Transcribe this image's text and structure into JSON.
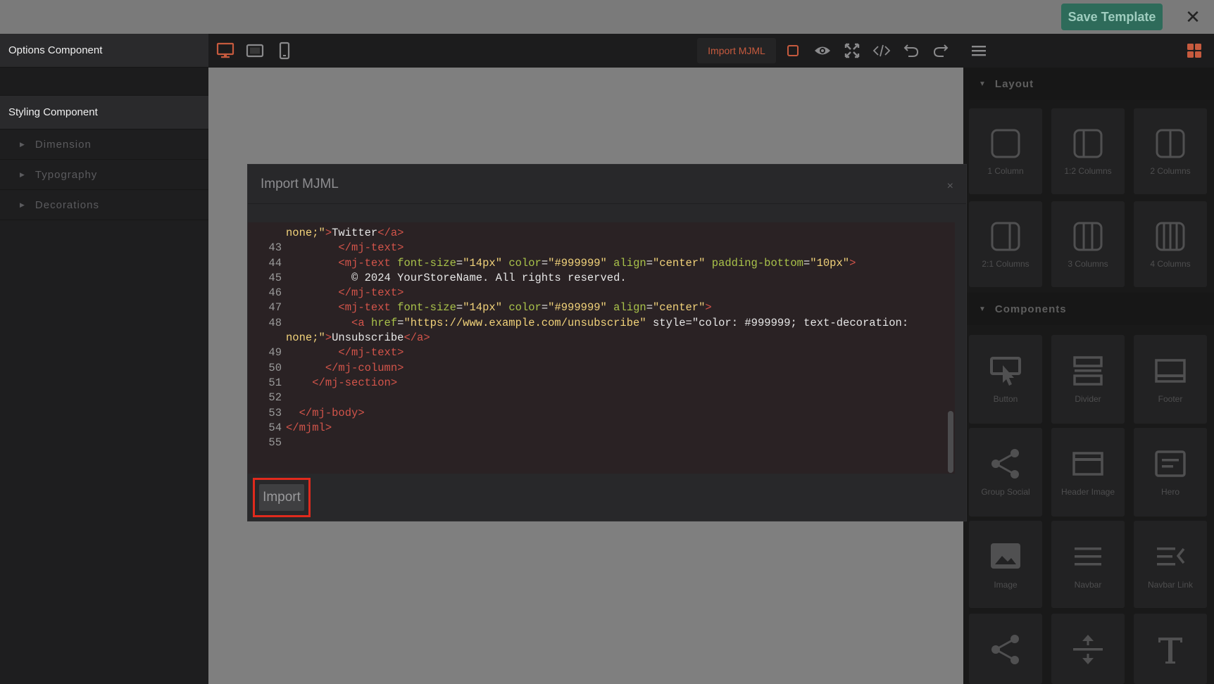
{
  "header": {
    "save_label": "Save Template",
    "close_glyph": "✕"
  },
  "left_panel": {
    "options_title": "Options Component",
    "styling_title": "Styling Component",
    "sections": [
      "Dimension",
      "Typography",
      "Decorations"
    ]
  },
  "toolbar": {
    "import_mjml_label": "Import MJML",
    "icons": [
      "desktop-icon",
      "tablet-icon",
      "mobile-icon",
      "square-outline-icon",
      "eye-icon",
      "fullscreen-icon",
      "code-icon",
      "undo-icon",
      "redo-icon",
      "menu-icon",
      "grid-icon"
    ]
  },
  "right_panel": {
    "layout_title": "Layout",
    "layout_blocks": [
      "1 Column",
      "1:2 Columns",
      "2 Columns",
      "2:1 Columns",
      "3 Columns",
      "4 Columns"
    ],
    "components_title": "Components",
    "component_blocks": [
      "Button",
      "Divider",
      "Footer",
      "Group Social",
      "Header Image",
      "Hero",
      "Image",
      "Navbar",
      "Navbar Link"
    ]
  },
  "modal": {
    "title": "Import MJML",
    "close_glyph": "×",
    "import_label": "Import",
    "code_lines": [
      {
        "n": "",
        "t": "none;\">Twitter</a>"
      },
      {
        "n": "43",
        "t": "        </mj-text>"
      },
      {
        "n": "44",
        "t": "        <mj-text font-size=\"14px\" color=\"#999999\" align=\"center\" padding-bottom=\"10px\">"
      },
      {
        "n": "45",
        "t": "          © 2024 YourStoreName. All rights reserved."
      },
      {
        "n": "46",
        "t": "        </mj-text>"
      },
      {
        "n": "47",
        "t": "        <mj-text font-size=\"14px\" color=\"#999999\" align=\"center\">"
      },
      {
        "n": "48",
        "t": "          <a href=\"https://www.example.com/unsubscribe\" style=\"color: #999999; text-decoration:"
      },
      {
        "n": "",
        "t": "none;\">Unsubscribe</a>"
      },
      {
        "n": "49",
        "t": "        </mj-text>"
      },
      {
        "n": "50",
        "t": "      </mj-column>"
      },
      {
        "n": "51",
        "t": "    </mj-section>"
      },
      {
        "n": "52",
        "t": ""
      },
      {
        "n": "53",
        "t": "  </mj-body>"
      },
      {
        "n": "54",
        "t": "</mjml>"
      },
      {
        "n": "55",
        "t": ""
      }
    ]
  },
  "colors": {
    "save_bg": "#2e6b5a",
    "accent_orange": "#c65a3e",
    "highlight_red": "#e02a1d"
  }
}
